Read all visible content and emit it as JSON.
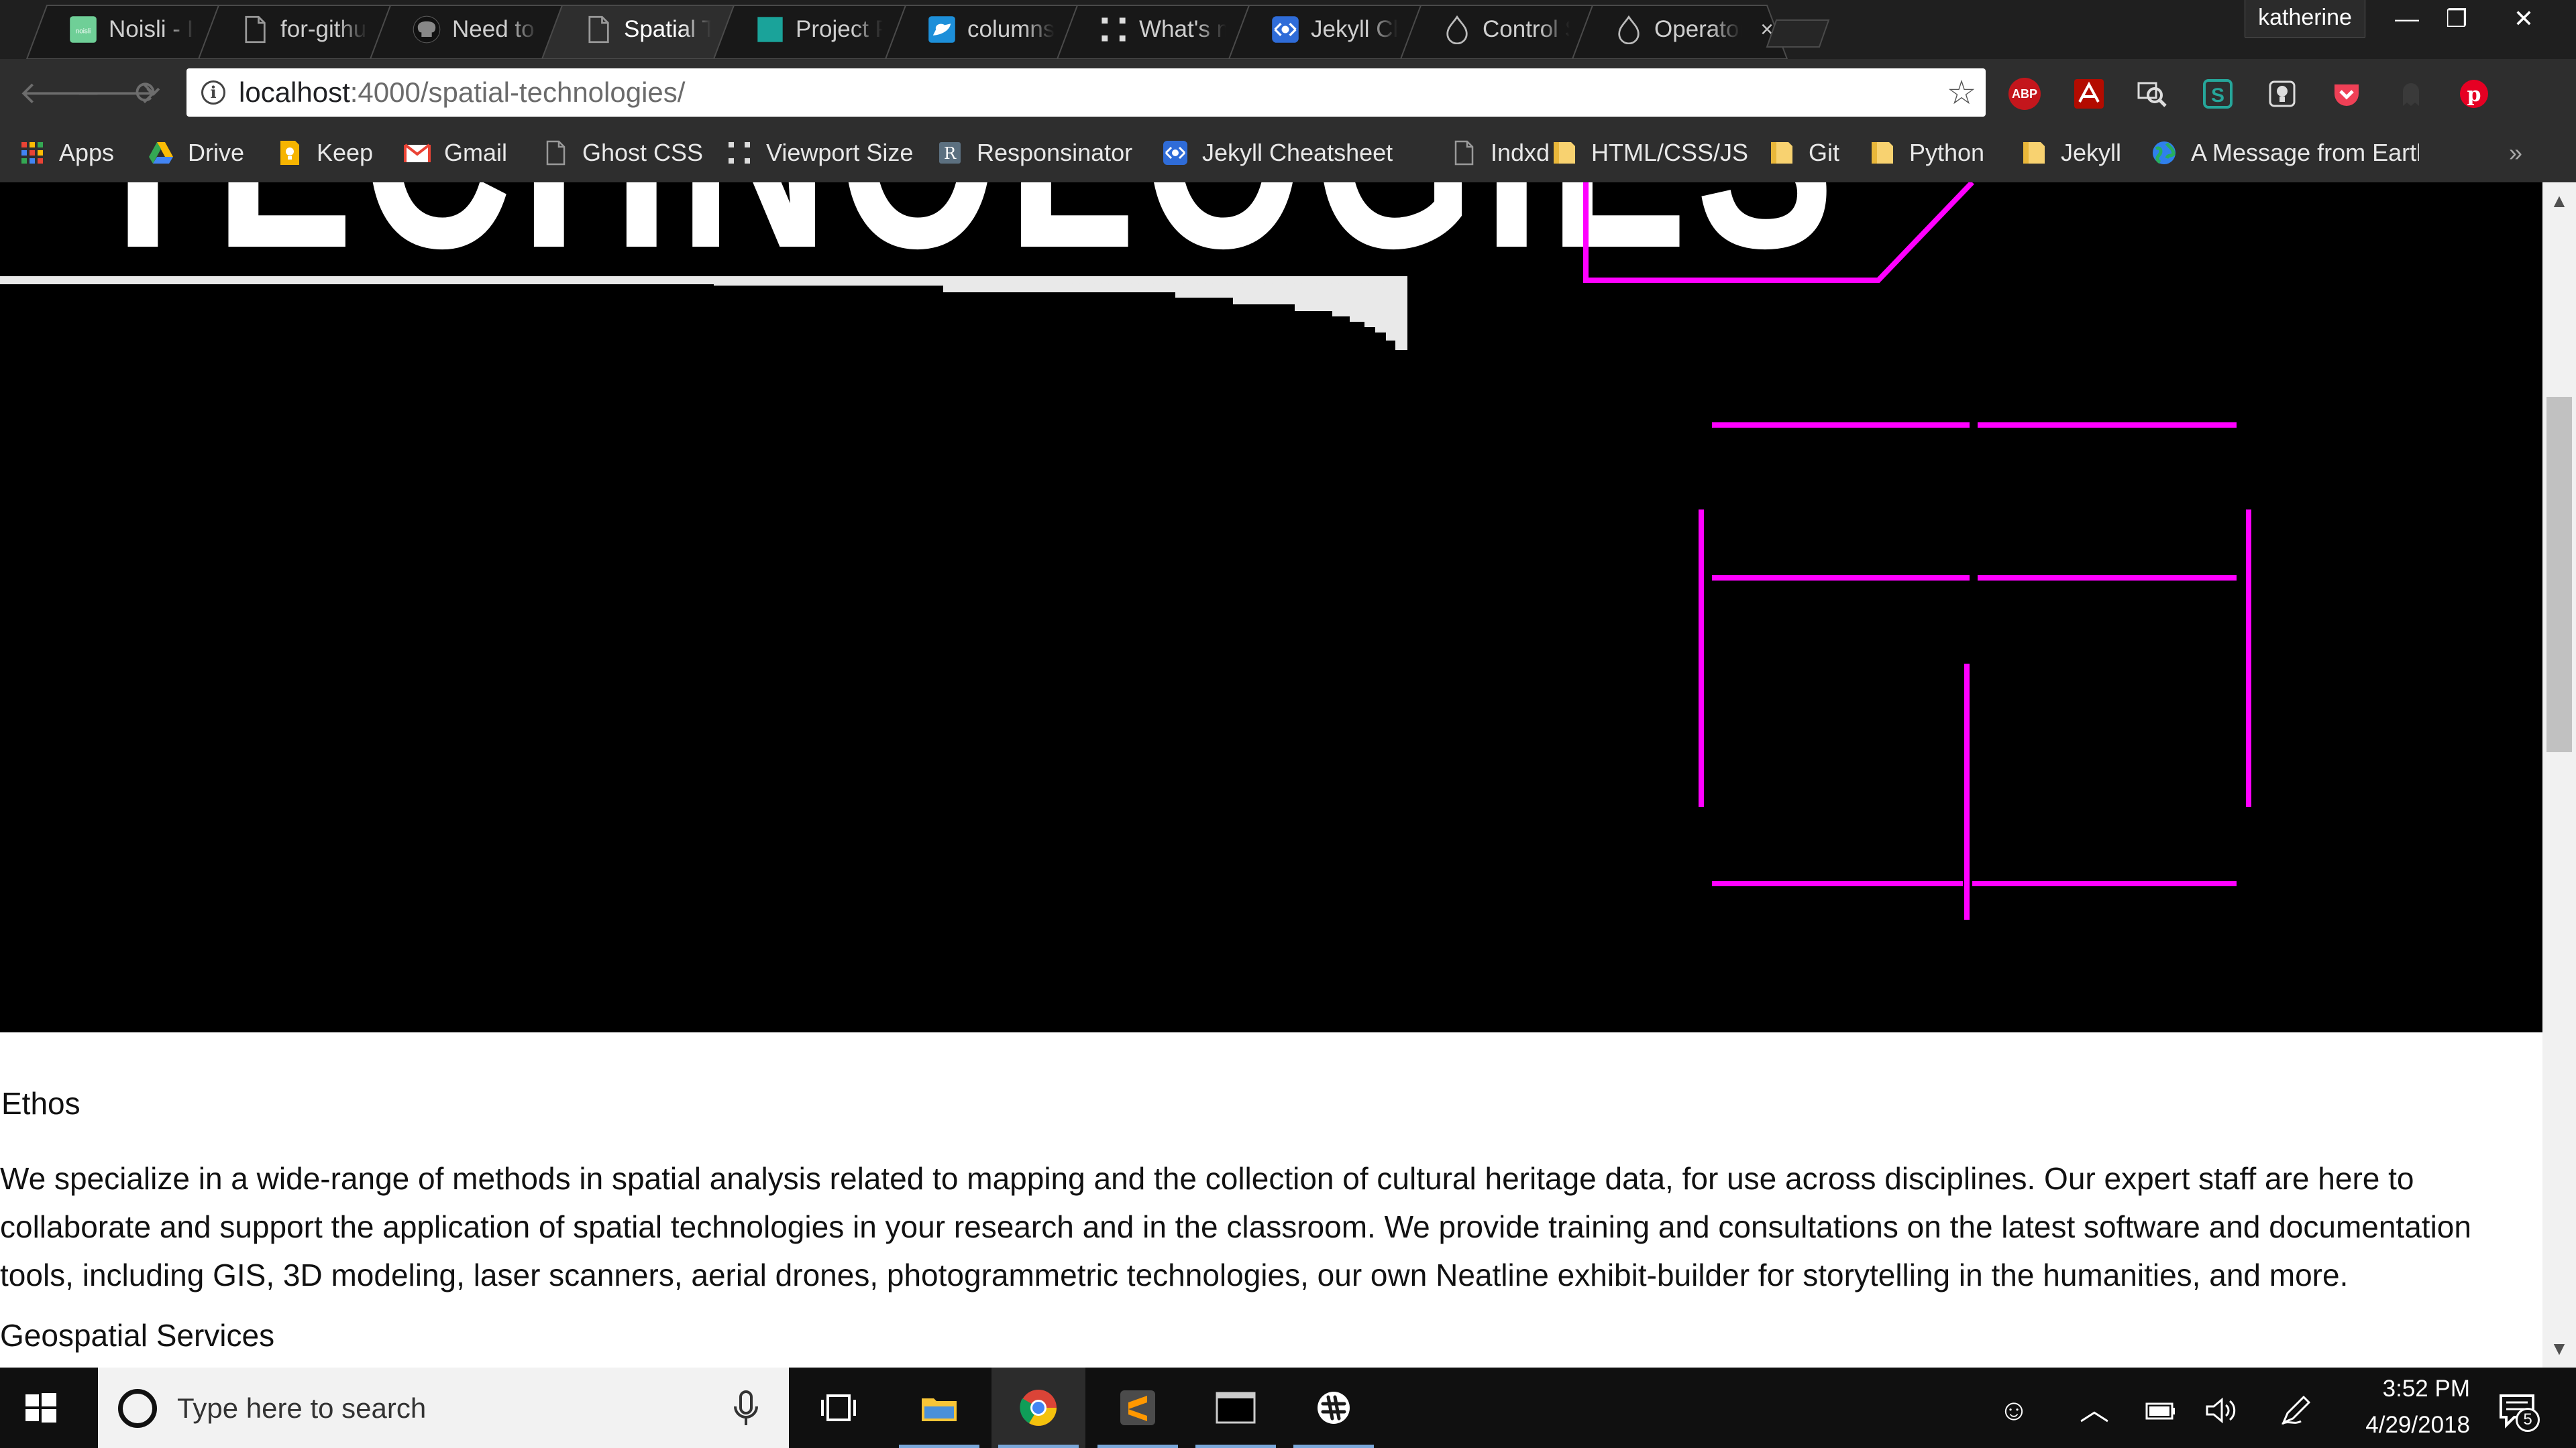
{
  "browser": {
    "tabs": [
      {
        "title": "Noisli - Improve Focus",
        "favicon": "noisli-icon",
        "active": false
      },
      {
        "title": "for-github-pages",
        "favicon": "page-icon",
        "active": false
      },
      {
        "title": "Need to know",
        "favicon": "github-icon",
        "active": false
      },
      {
        "title": "Spatial Technologies",
        "favicon": "page-icon",
        "active": true
      },
      {
        "title": "Project Page",
        "favicon": "teal-square-icon",
        "active": false
      },
      {
        "title": "columns",
        "favicon": "blue-bird-icon",
        "active": false
      },
      {
        "title": "What's my viewport",
        "favicon": "viewport-icon",
        "active": false
      },
      {
        "title": "Jekyll Cheatsheet",
        "favicon": "devhints-icon",
        "active": false
      },
      {
        "title": "Control Structures",
        "favicon": "drupal-icon",
        "active": false
      },
      {
        "title": "Operators",
        "favicon": "drupal-icon",
        "active": false
      }
    ],
    "tab_close_glyph": "×",
    "profile_name": "katherine",
    "window_controls": {
      "minimize": "—",
      "restore": "❐",
      "close": "✕"
    },
    "url_host": "localhost",
    "url_rest": ":4000/spatial-technologies/",
    "bookmarks": [
      {
        "label": "Apps",
        "icon": "apps-grid-icon"
      },
      {
        "label": "Drive",
        "icon": "drive-icon"
      },
      {
        "label": "Keep",
        "icon": "keep-icon"
      },
      {
        "label": "Gmail",
        "icon": "gmail-icon"
      },
      {
        "label": "Ghost CSS",
        "icon": "page-icon"
      },
      {
        "label": "Viewport Size",
        "icon": "viewport-icon"
      },
      {
        "label": "Responsinator",
        "icon": "responsinator-icon"
      },
      {
        "label": "Jekyll Cheatsheet",
        "icon": "devhints-icon"
      },
      {
        "label": "Indxd",
        "icon": "page-icon"
      },
      {
        "label": "HTML/CSS/JS",
        "icon": "folder-icon"
      },
      {
        "label": "Git",
        "icon": "folder-icon"
      },
      {
        "label": "Python",
        "icon": "folder-icon"
      },
      {
        "label": "Jekyll",
        "icon": "folder-icon"
      },
      {
        "label": "A Message from Earth",
        "icon": "earth-icon"
      }
    ],
    "overflow_glyph": "»",
    "extensions": [
      "adblock-plus-icon",
      "acrobat-icon",
      "inspect-icon",
      "s-extension-icon",
      "lightbulb-icon",
      "pocket-icon",
      "ghostery-icon",
      "pinterest-icon"
    ],
    "extension_abp_text": "ABP"
  },
  "page": {
    "hero_title": "TECHNOLOGIES",
    "sections": [
      {
        "heading": "Ethos",
        "body": "We specialize in a wide-range of methods in spatial analysis related to mapping and the collection of cultural heritage data, for use across disciplines. Our expert staff are here to collaborate and support the application of spatial technologies in your research and in the classroom. We provide training and consultations on the latest software and documentation tools, including GIS, 3D modeling, laser scanners, aerial drones, photogrammetric technologies, our own Neatline exhibit-builder for storytelling in the humanities, and more."
      },
      {
        "heading": "Geospatial Services"
      }
    ],
    "accent_color": "#ff00ff"
  },
  "taskbar": {
    "search_placeholder": "Type here to search",
    "apps": [
      "task-view-icon",
      "file-explorer-icon",
      "chrome-icon",
      "sublime-text-icon",
      "terminal-icon",
      "slack-icon"
    ],
    "clock_time": "3:52 PM",
    "clock_date": "4/29/2018",
    "notification_count": "5"
  }
}
